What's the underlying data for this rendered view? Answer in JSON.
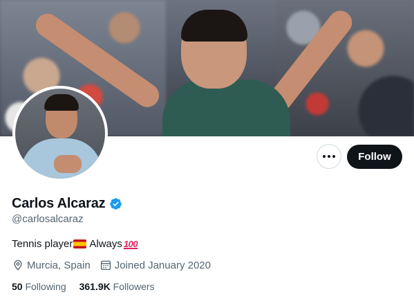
{
  "profile": {
    "display_name": "Carlos Alcaraz",
    "handle": "@carlosalcaraz",
    "verified": true,
    "bio": {
      "text_before_flag": "Tennis player",
      "flag_icon": "spain-flag-emoji",
      "text_after_flag": " Always",
      "emoji_icon": "hundred-points-emoji",
      "emoji_text": "100"
    },
    "location": "Murcia, Spain",
    "joined": "Joined January 2020",
    "following_count": "50",
    "following_label": "Following",
    "followers_count": "361.9K",
    "followers_label": "Followers"
  },
  "actions": {
    "follow_label": "Follow",
    "more_icon": "more-horizontal-icon"
  },
  "colors": {
    "text_primary": "#0f1419",
    "text_secondary": "#536471",
    "verified_blue": "#1d9bf0",
    "follow_button_bg": "#0f1419",
    "border": "#cfd9de"
  }
}
